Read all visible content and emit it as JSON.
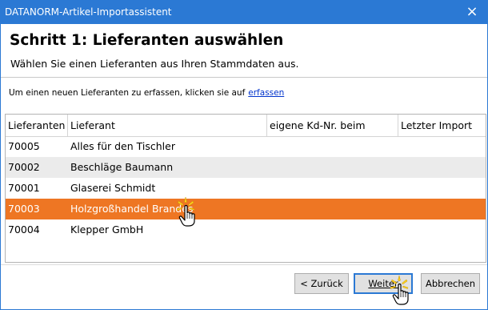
{
  "window": {
    "title": "DATANORM-Artikel-Importassistent",
    "close_glyph": "×"
  },
  "step": {
    "title": "Schritt 1: Lieferanten auswählen",
    "subtitle": "Wählen Sie einen Lieferanten aus Ihren Stammdaten aus."
  },
  "hint": {
    "text": "Um einen neuen Lieferanten zu erfassen, klicken sie auf",
    "link_label": "erfassen"
  },
  "table": {
    "columns": [
      "Lieferanten",
      "Lieferant",
      "eigene Kd-Nr. beim",
      "Letzter Import"
    ],
    "rows": [
      {
        "nr": "70005",
        "name": "Alles für den Tischler",
        "kdnr": "",
        "last_import": ""
      },
      {
        "nr": "70002",
        "name": "Beschläge Baumann",
        "kdnr": "",
        "last_import": ""
      },
      {
        "nr": "70001",
        "name": "Glaserei Schmidt",
        "kdnr": "",
        "last_import": ""
      },
      {
        "nr": "70003",
        "name": "Holzgroßhandel Brandes",
        "kdnr": "",
        "last_import": ""
      },
      {
        "nr": "70004",
        "name": "Klepper GmbH",
        "kdnr": "",
        "last_import": ""
      }
    ],
    "selected_row": "70003",
    "selection_color": "#ee7623"
  },
  "buttons": {
    "back_label": "< Zurück",
    "next_label": "Weiter",
    "cancel_label": "Abbrechen"
  },
  "icons": {
    "pointer": "hand-pointer-icon",
    "click": "click-burst-icon"
  },
  "colors": {
    "titlebar": "#2b79d4",
    "link": "#0033cc"
  }
}
